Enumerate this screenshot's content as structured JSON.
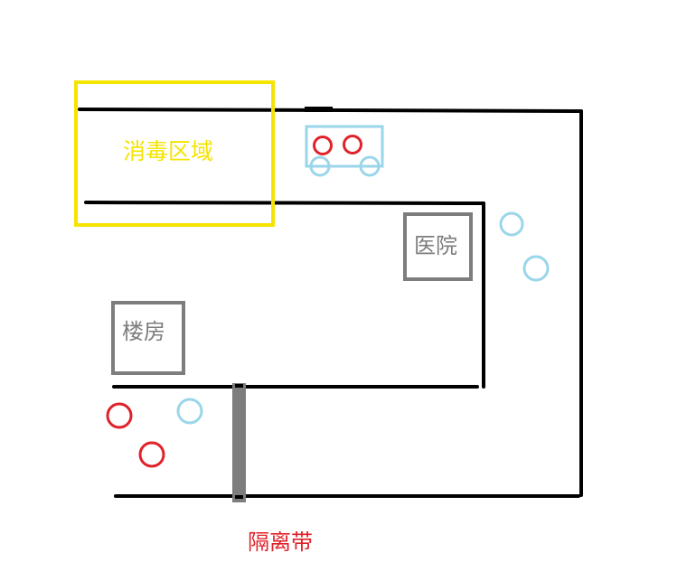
{
  "labels": {
    "disinfection_zone": "消毒区域",
    "hospital": "医院",
    "building": "楼房",
    "isolation_belt": "隔离带"
  },
  "colors": {
    "road": "#000000",
    "disinfection": "#f5e400",
    "building": "#7d7d7d",
    "red_person": "#e0222a",
    "blue_person": "#9ad6ea",
    "barrier": "#7d7d7d"
  }
}
